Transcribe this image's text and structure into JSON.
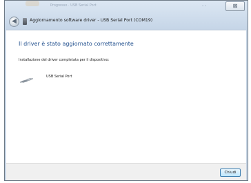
{
  "window": {
    "background_title": "Progresso · USB Serial Port",
    "close_glyph": "⊠"
  },
  "header": {
    "back_glyph": "◀",
    "title": "Aggiornamento software driver - USB Serial Port (COM19)"
  },
  "main": {
    "title": "Il driver è stato aggiornato correttamente",
    "description": "Installazione del driver completata per il dispositivo:",
    "device": {
      "icon": "usb-cable-icon",
      "label": "USB Serial Port"
    }
  },
  "footer": {
    "close_label": "Chiudi"
  },
  "colors": {
    "title_blue": "#1e4d8c",
    "frame": "#c8d6e6",
    "button_border": "#3c7fb1"
  }
}
